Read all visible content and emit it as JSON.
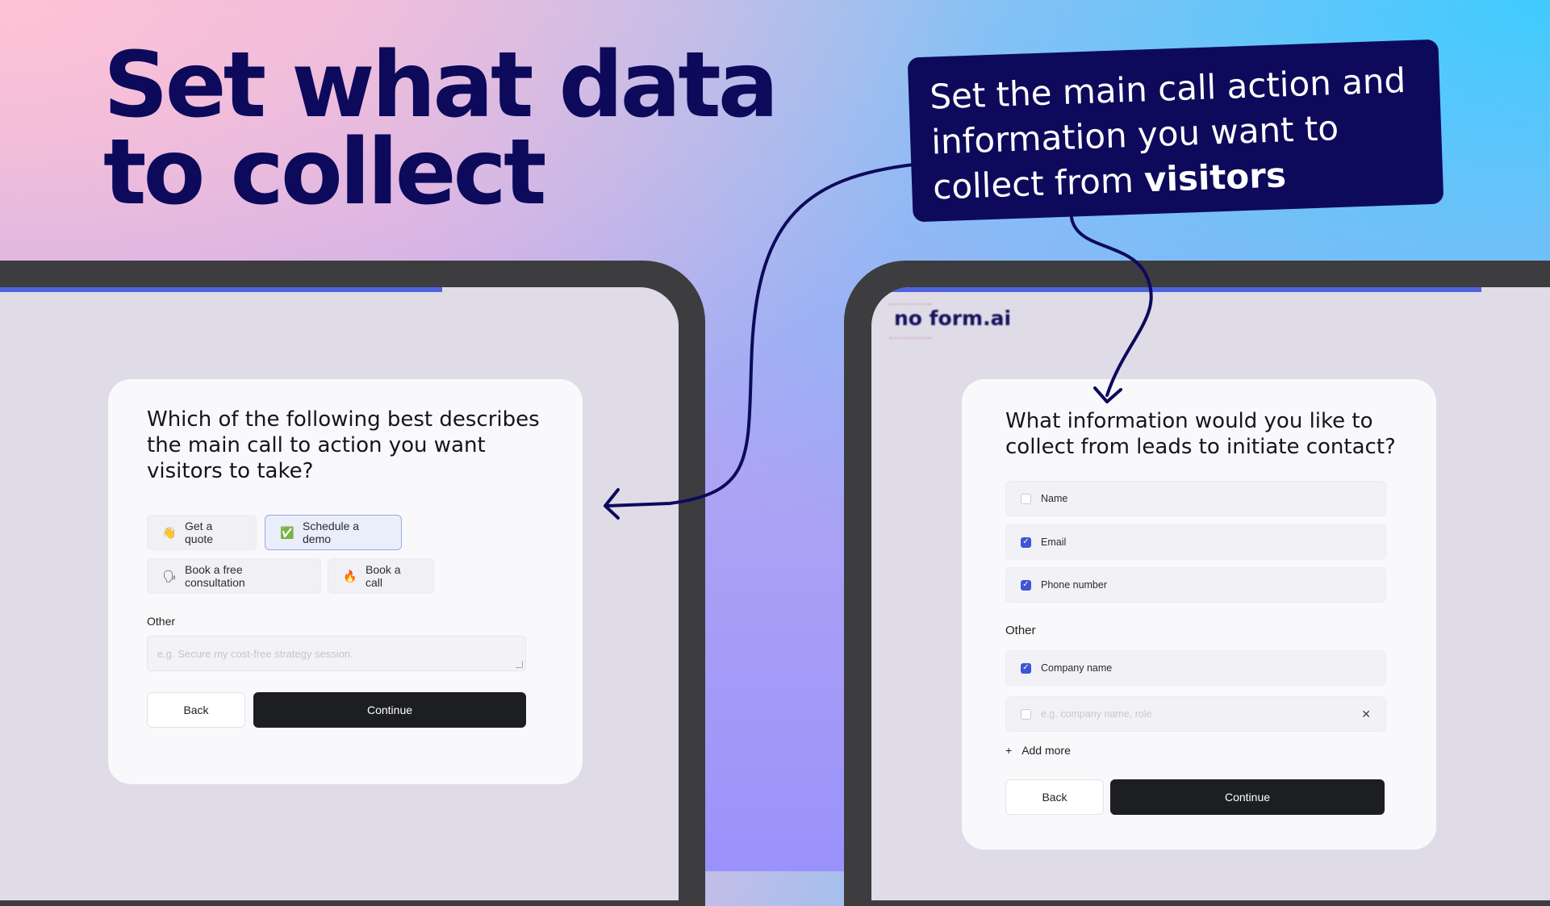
{
  "headline": {
    "line1": "Set what data",
    "line2": "to collect"
  },
  "callout": {
    "text_plain": "Set the main call action and information you want to collect from",
    "text_bold": "visitors"
  },
  "logo": {
    "text": "no form.ai"
  },
  "left_form": {
    "question": "Which of the following best describes the main call to action you want visitors to take?",
    "options": [
      {
        "emoji": "👋",
        "label": "Get a quote",
        "selected": false
      },
      {
        "emoji": "✅",
        "label": "Schedule a demo",
        "selected": true
      },
      {
        "emoji": "🗣",
        "label": "Book a free consultation",
        "selected": false
      },
      {
        "emoji": "🔥",
        "label": "Book a call",
        "selected": false
      }
    ],
    "other_label": "Other",
    "other_placeholder": "e.g. Secure my cost-free strategy session.",
    "back_label": "Back",
    "continue_label": "Continue"
  },
  "right_form": {
    "question": "What information would you like to collect from leads to initiate contact?",
    "fields": [
      {
        "label": "Name",
        "checked": false
      },
      {
        "label": "Email",
        "checked": true
      },
      {
        "label": "Phone number",
        "checked": true
      }
    ],
    "other_label": "Other",
    "other_fields": [
      {
        "label": "Company name",
        "checked": true
      }
    ],
    "new_field_placeholder": "e.g. company name, role",
    "add_more_label": "Add more",
    "back_label": "Back",
    "continue_label": "Continue"
  },
  "colors": {
    "navy": "#0d0a5c",
    "accent": "#3e55d6",
    "dark_button": "#1d1e22"
  }
}
